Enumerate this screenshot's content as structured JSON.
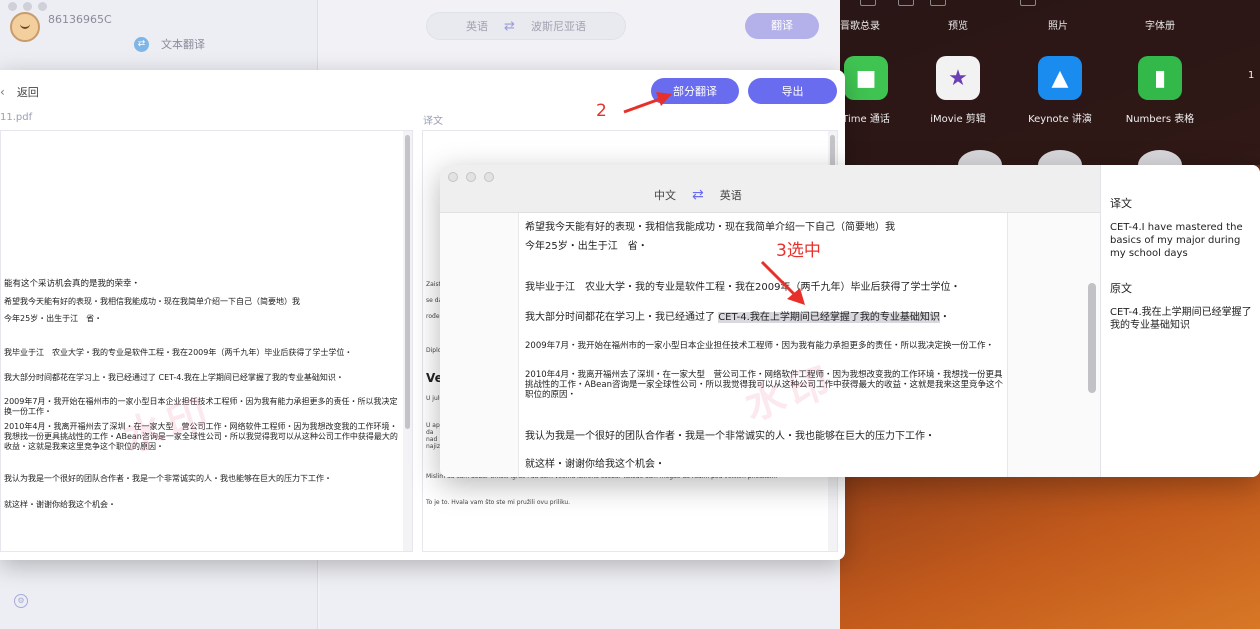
{
  "bg_app": {
    "user_id": "86136965C",
    "menu_item": "文本翻译",
    "lang_from": "英语",
    "lang_to": "波斯尼亚语",
    "translate_button": "翻译"
  },
  "launchpad": {
    "top_labels": [
      "晋歌总录",
      "预览",
      "照片",
      "字体册"
    ],
    "apps": [
      {
        "label": "Time 通话",
        "icon": "facetime-icon",
        "color": "#3fc351"
      },
      {
        "label": "iMovie 剪辑",
        "icon": "imovie-icon",
        "color": "#f2f2f2"
      },
      {
        "label": "Keynote 讲演",
        "icon": "keynote-icon",
        "color": "#1a8cf0"
      },
      {
        "label": "Numbers 表格",
        "icon": "numbers-icon",
        "color": "#33b84a"
      }
    ],
    "side_number": "1"
  },
  "dialog": {
    "back_label": "返回",
    "source_label": "11.pdf",
    "target_label": "译文",
    "partial_translate_button": "部分翻译",
    "export_button": "导出",
    "source_lines": [
      "能有这个采访机会真的是我的荣幸・",
      "希望我今天能有好的表现・我相信我能成功・现在我简单介绍一下自己（简要地）我",
      "今年25岁・出生于江　省・",
      "我毕业于江　农业大学・我的专业是软件工程・我在2009年（两千九年）毕业后获得了学士学位・",
      "我大部分时间都花在学习上・我已经通过了 CET-4.我在上学期间已经掌握了我的专业基础知识・",
      "2009年7月・我开始在福州市的一家小型日本企业担任技术工程师・因为我有能力承担更多的责任・所以我决定换一份工作・",
      "2010年4月・我离开福州去了深圳・在一家大型　营公司工作・网络软件工程师・因为我想改变我的工作环境・我想找一份更具挑战性的工作・ABean咨询是一家全球性公司・所以我觉得我可以从这种公司工作中获得最大的收益・这就是我来这里竞争这个职位的原因・",
      "我认为我是一个很好的团队合作者・我是一个非常诚实的人・我也能够在巨大的压力下工作・",
      "就这样・谢谢你给我这个机会・"
    ],
    "target_lines": [
      "Zaist",
      "se da",
      "rođen",
      "Diplo",
      "Ve",
      "U julu 2",
      "U april da nad najizaz",
      "Mislim",
      "To je to. Hvala vam što ste mi pružili ovu priliku."
    ],
    "target_bottom_line": "Mislim da sam dobar timski igrač i da sam veoma iskrena osoba. Takođe sam mogao da radim pod velikim pritiskom."
  },
  "annotations": {
    "step2": "2",
    "step3": "3选中"
  },
  "popup": {
    "lang_from": "中文",
    "lang_to": "英语",
    "lines": [
      "希望我今天能有好的表现・我相信我能成功・现在我简单介绍一下自己（简要地）我",
      "今年25岁・出生于江　省・",
      "我毕业于江　农业大学・我的专业是软件工程・我在2009年（两千九年）毕业后获得了学士学位・",
      "我大部分时间都花在学习上・我已经通过了 ",
      "CET-4.我在上学期间已经掌握了我的专业基础知识",
      "・",
      "2009年7月・我开始在福州市的一家小型日本企业担任技术工程师・因为我有能力承担更多的责任・所以我决定换一份工作・",
      "2010年4月・我离开福州去了深圳・在一家大型　营公司工作・网络软件工程师・因为我想改变我的工作环境・我想找一份更具挑战性的工作・ABean咨询是一家全球性公司・所以我觉得我可以从这种公司工作中获得最大的收益・这就是我来这里竞争这个职位的原因・",
      "我认为我是一个很好的团队合作者・我是一个非常诚实的人・我也能够在巨大的压力下工作・",
      "就这样・谢谢你给我这个机会・"
    ],
    "side": {
      "translation_heading": "译文",
      "translation_text": "CET-4.I have mastered the basics of my major during my school days",
      "original_heading": "原文",
      "original_text": "CET-4.我在上学期间已经掌握了我的专业基础知识"
    }
  },
  "colors": {
    "accent": "#6a6cf0",
    "annotation_red": "#e8302a"
  }
}
